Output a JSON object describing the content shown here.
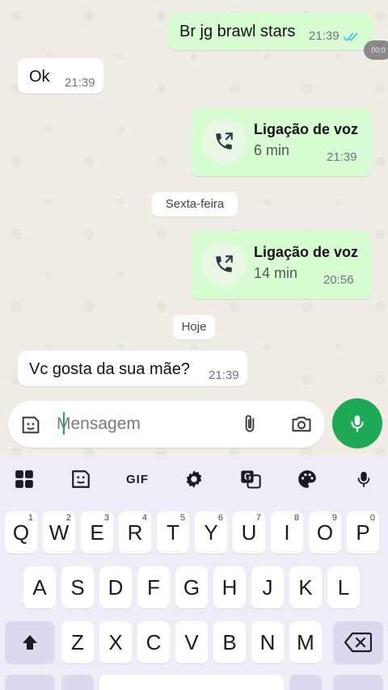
{
  "messages": [
    {
      "text": "Br jg brawl stars",
      "time": "21:39"
    },
    {
      "text": "Ok",
      "time": "21:39"
    },
    {
      "text": "Vc gosta da sua mãe?",
      "time": "21:39"
    }
  ],
  "calls": [
    {
      "title": "Ligação de voz",
      "duration": "6 min",
      "time": "21:39"
    },
    {
      "title": "Ligação de voz",
      "duration": "14 min",
      "time": "20:56"
    }
  ],
  "date_chips": [
    "Sexta-feira",
    "Hoje"
  ],
  "side_badge": "00:0",
  "composer": {
    "placeholder": "Mensagem"
  },
  "keyboard": {
    "toolbar": {
      "gif_label": "GIF"
    },
    "row1": [
      "Q",
      "W",
      "E",
      "R",
      "T",
      "Y",
      "U",
      "I",
      "O",
      "P"
    ],
    "row1_hints": [
      "1",
      "2",
      "3",
      "4",
      "5",
      "6",
      "7",
      "8",
      "9",
      "0"
    ],
    "row2": [
      "A",
      "S",
      "D",
      "F",
      "G",
      "H",
      "J",
      "K",
      "L"
    ],
    "row3": [
      "Z",
      "X",
      "C",
      "V",
      "B",
      "N",
      "M"
    ]
  },
  "colors": {
    "accent": "#1fa855",
    "outgoing_bubble": "#d9fdd3",
    "read_ticks": "#53bdeb"
  }
}
